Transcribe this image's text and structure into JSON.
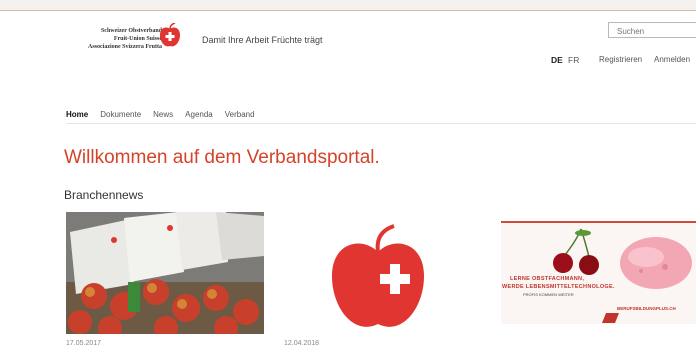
{
  "header": {
    "logo_lines": [
      "Schweizer Obstverband",
      "Fruit-Union Suisse",
      "Associazione Svizzera Frutta"
    ],
    "tagline": "Damit Ihre Arbeit Früchte trägt",
    "search_placeholder": "Suchen",
    "languages": {
      "de": "DE",
      "fr": "FR",
      "active": "DE"
    },
    "account": {
      "register": "Registrieren",
      "login": "Anmelden"
    }
  },
  "nav": {
    "items": [
      {
        "label": "Home",
        "active": true
      },
      {
        "label": "Dokumente",
        "active": false
      },
      {
        "label": "News",
        "active": false
      },
      {
        "label": "Agenda",
        "active": false
      },
      {
        "label": "Verband",
        "active": false
      }
    ]
  },
  "main": {
    "welcome": "Willkommen auf dem Verbandsportal.",
    "section_title": "Branchennews",
    "news": [
      {
        "date": "17.05.2017"
      },
      {
        "date": "12.04.2018"
      }
    ],
    "ad": {
      "line1": "LERNE OBSTFACHMANN,",
      "line2": "WERDE LEBENSMITTELTECHNOLOGE.",
      "line3": "PROFIS KOMMEN WEITER",
      "brand": "BERUFSBILDUNGPLUS.CH"
    }
  },
  "colors": {
    "accent": "#d4432a",
    "apple_red": "#e03530"
  }
}
